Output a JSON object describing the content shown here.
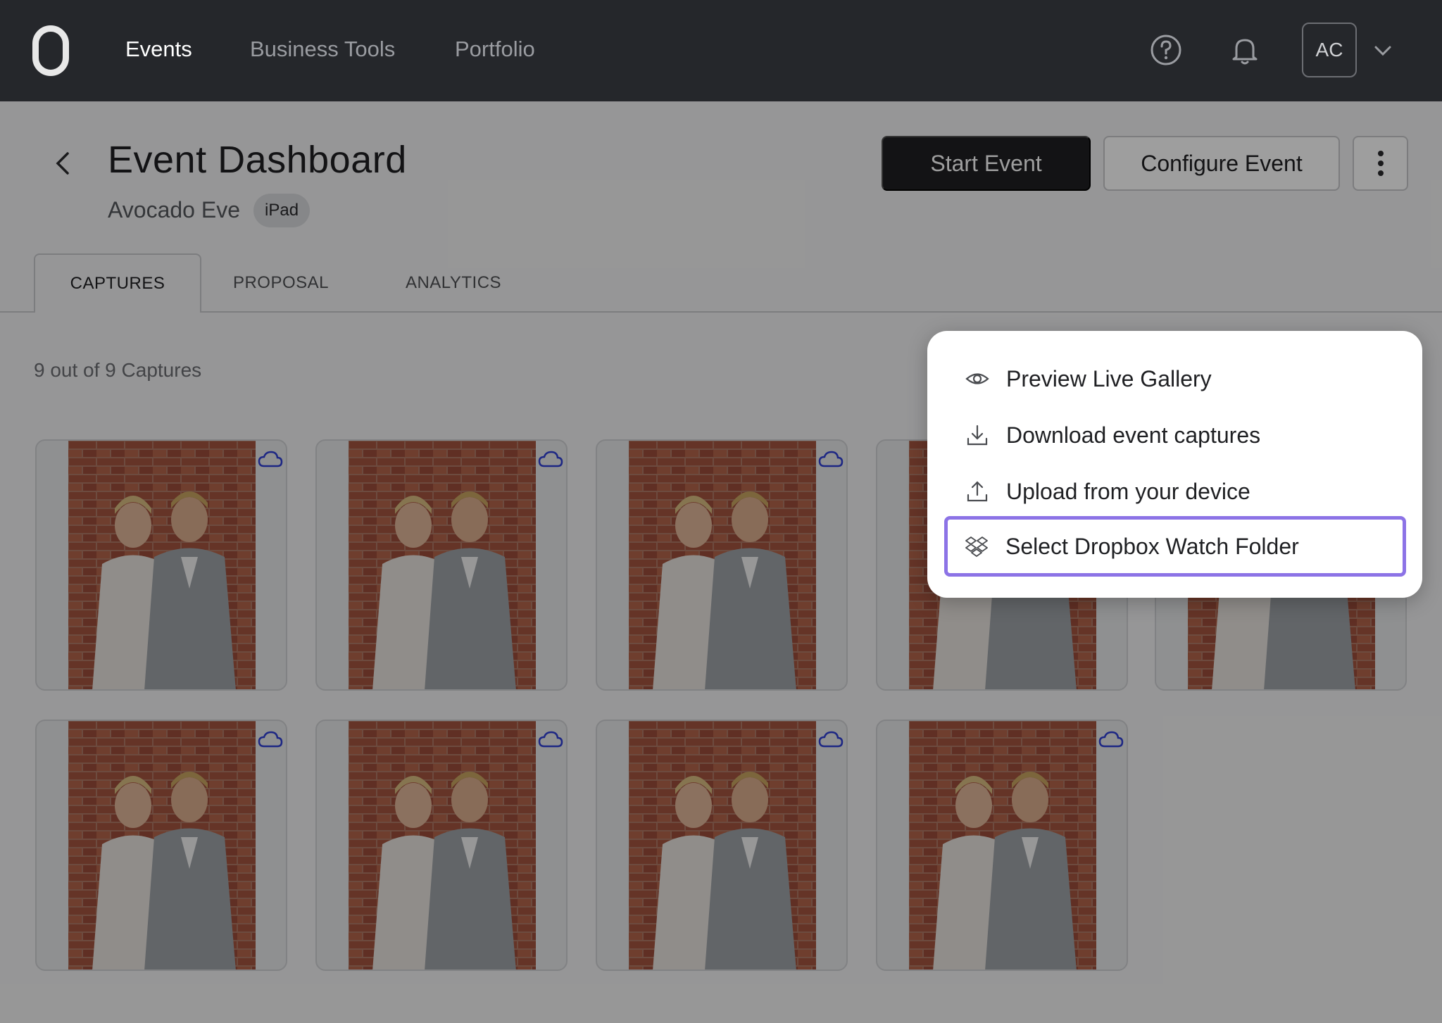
{
  "nav": {
    "links": [
      {
        "label": "Events"
      },
      {
        "label": "Business Tools"
      },
      {
        "label": "Portfolio"
      }
    ],
    "icons": [
      "help-icon",
      "bell-icon",
      "chevron-down-icon"
    ],
    "avatar_initials": "AC"
  },
  "header": {
    "title": "Event Dashboard",
    "event_name": "Avocado Eve",
    "device_badge": "iPad",
    "start_button": "Start Event",
    "configure_button": "Configure Event"
  },
  "tabs": [
    {
      "label": "CAPTURES",
      "active": true
    },
    {
      "label": "PROPOSAL",
      "active": false
    },
    {
      "label": "ANALYTICS",
      "active": false
    }
  ],
  "captures": {
    "count_text": "9 out of 9 Captures",
    "items": [
      {
        "status_icon": "cloud-icon"
      },
      {
        "status_icon": "cloud-icon"
      },
      {
        "status_icon": "cloud-icon"
      },
      {
        "status_icon": "cloud-icon"
      },
      {
        "status_icon": "cloud-icon"
      },
      {
        "status_icon": "cloud-icon"
      },
      {
        "status_icon": "cloud-icon"
      },
      {
        "status_icon": "cloud-icon"
      },
      {
        "status_icon": "cloud-icon"
      }
    ]
  },
  "menu": {
    "items": [
      {
        "label": "Preview Live Gallery",
        "icon": "eye-icon"
      },
      {
        "label": "Download event captures",
        "icon": "download-icon"
      },
      {
        "label": "Upload from your device",
        "icon": "upload-icon"
      },
      {
        "label": "Select Dropbox Watch Folder",
        "icon": "dropbox-icon",
        "focused": true
      }
    ]
  },
  "colors": {
    "nav_bg": "#25272b",
    "primary_button": "#1f2023",
    "focus_ring": "#8c73e6",
    "cloud_icon": "#2f3fd6",
    "brick": "#9b5a45"
  }
}
